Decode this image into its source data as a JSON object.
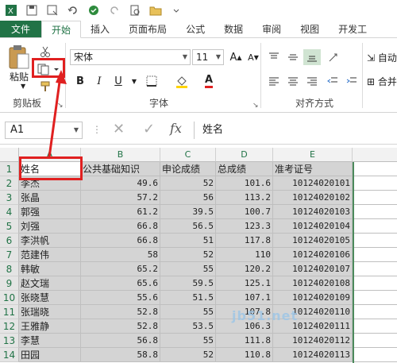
{
  "tabs": [
    "文件",
    "开始",
    "插入",
    "页面布局",
    "公式",
    "数据",
    "审阅",
    "视图",
    "开发工"
  ],
  "ribbon": {
    "paste_label": "粘贴",
    "clipboard_label": "剪贴板",
    "font_name": "宋体",
    "font_size": "11",
    "font_label": "字体",
    "align_label": "对齐方式",
    "auto_label": "自动",
    "merge_label": "合并",
    "bold": "B",
    "italic": "I",
    "underline": "U",
    "font_color_letter": "A"
  },
  "formula_bar": {
    "name_box": "A1",
    "fx": "fx",
    "content": "姓名"
  },
  "columns": [
    "A",
    "B",
    "C",
    "D",
    "E"
  ],
  "rows": [
    {
      "n": "1",
      "name": "姓名",
      "b": "公共基础知识",
      "c": "申论成绩",
      "d": "总成绩",
      "e": "准考证号"
    },
    {
      "n": "2",
      "name": "李杰",
      "b": "49.6",
      "c": "52",
      "d": "101.6",
      "e": "10124020101"
    },
    {
      "n": "3",
      "name": "张晶",
      "b": "57.2",
      "c": "56",
      "d": "113.2",
      "e": "10124020102"
    },
    {
      "n": "4",
      "name": "郭强",
      "b": "61.2",
      "c": "39.5",
      "d": "100.7",
      "e": "10124020103"
    },
    {
      "n": "5",
      "name": "刘强",
      "b": "66.8",
      "c": "56.5",
      "d": "123.3",
      "e": "10124020104"
    },
    {
      "n": "6",
      "name": "李洪帆",
      "b": "66.8",
      "c": "51",
      "d": "117.8",
      "e": "10124020105"
    },
    {
      "n": "7",
      "name": "范建伟",
      "b": "58",
      "c": "52",
      "d": "110",
      "e": "10124020106"
    },
    {
      "n": "8",
      "name": "韩敏",
      "b": "65.2",
      "c": "55",
      "d": "120.2",
      "e": "10124020107"
    },
    {
      "n": "9",
      "name": "赵文瑞",
      "b": "65.6",
      "c": "59.5",
      "d": "125.1",
      "e": "10124020108"
    },
    {
      "n": "10",
      "name": "张晓慧",
      "b": "55.6",
      "c": "51.5",
      "d": "107.1",
      "e": "10124020109"
    },
    {
      "n": "11",
      "name": "张瑞晓",
      "b": "52.8",
      "c": "55",
      "d": "107.8",
      "e": "10124020110"
    },
    {
      "n": "12",
      "name": "王雅静",
      "b": "52.8",
      "c": "53.5",
      "d": "106.3",
      "e": "10124020111"
    },
    {
      "n": "13",
      "name": "李慧",
      "b": "56.8",
      "c": "55",
      "d": "111.8",
      "e": "10124020112"
    },
    {
      "n": "14",
      "name": "田园",
      "b": "58.8",
      "c": "52",
      "d": "110.8",
      "e": "10124020113"
    }
  ],
  "watermark": "jb51.net",
  "colors": {
    "accent": "#217346",
    "highlight": "#e02020",
    "selection": "#d4d4d4"
  }
}
